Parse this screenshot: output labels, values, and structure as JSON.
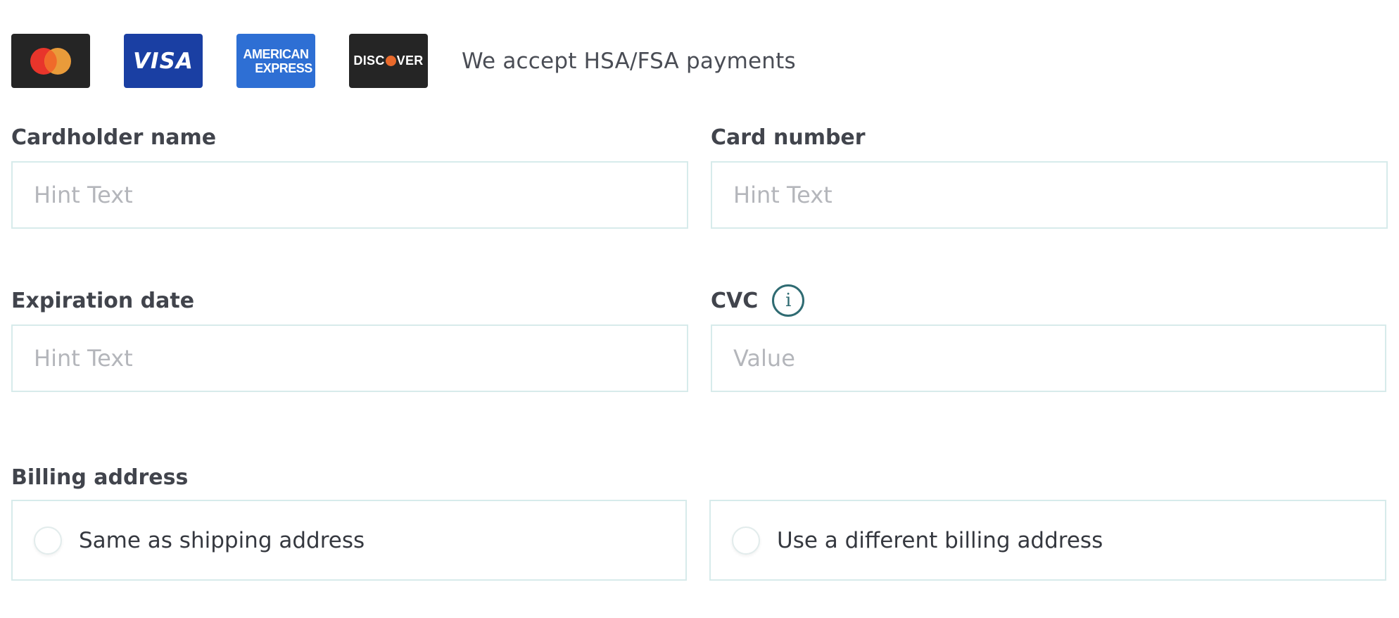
{
  "payment_logos": {
    "mastercard": {
      "name": "mastercard-logo-icon",
      "color_red": "#e8352b",
      "color_orange": "#f3a13b"
    },
    "visa": {
      "text": "VISA",
      "color": "#1a3fa3"
    },
    "amex": {
      "line1": "AMERICAN",
      "line2": "EXPRESS",
      "color": "#2e6fd4"
    },
    "discover": {
      "text_left": "DISC",
      "text_right": "VER",
      "dot_color": "#e8692b"
    }
  },
  "accept_text": "We accept HSA/FSA payments",
  "fields": {
    "cardholder_name": {
      "label": "Cardholder name",
      "placeholder": "Hint Text",
      "value": ""
    },
    "card_number": {
      "label": "Card number",
      "placeholder": "Hint Text",
      "value": ""
    },
    "expiration_date": {
      "label": "Expiration date",
      "placeholder": "Hint Text",
      "value": ""
    },
    "cvc": {
      "label": "CVC",
      "placeholder": "Value",
      "value": "",
      "info_icon": "info-icon"
    }
  },
  "billing": {
    "label": "Billing address",
    "options": [
      {
        "label": "Same as shipping address",
        "selected": false
      },
      {
        "label": "Use a different billing address",
        "selected": false
      }
    ]
  },
  "colors": {
    "input_border": "#d7ebeb",
    "label_text": "#41444c",
    "placeholder": "#b4b6bb",
    "info_accent": "#2f6b72"
  }
}
